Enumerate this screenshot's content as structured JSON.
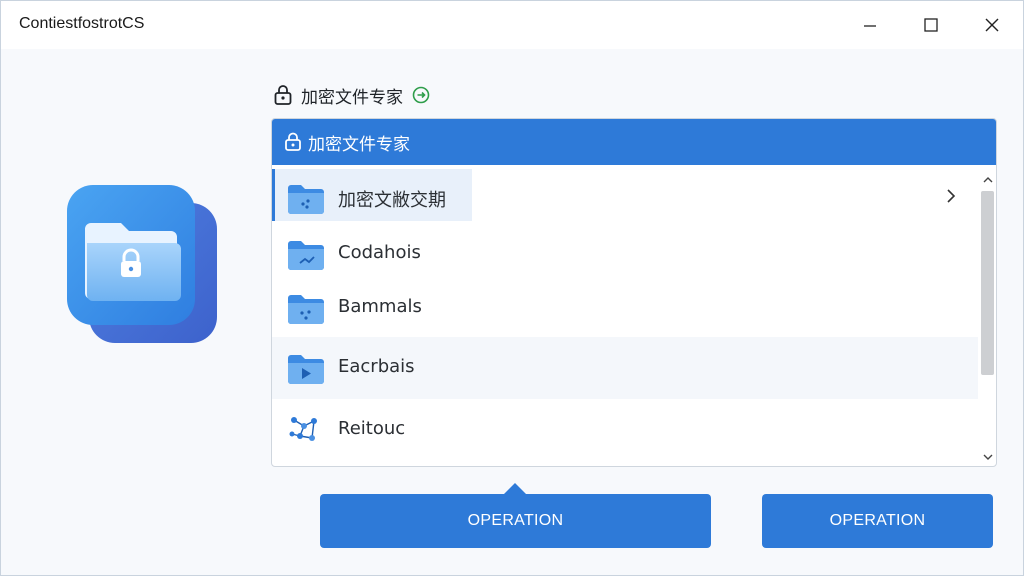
{
  "window": {
    "title": "ContiestfostrotCS"
  },
  "header": {
    "label": "加密文件专家",
    "lock_icon": "lock-icon",
    "status_icon": "sync-status-icon",
    "status_color": "#2e9d4a"
  },
  "panel": {
    "title": "加密文件专家",
    "accent": "#2e7ad8",
    "items": [
      {
        "label": "加密文敝交期",
        "icon": "folder-icon",
        "selected": true
      },
      {
        "label": "Codahois",
        "icon": "folder-icon"
      },
      {
        "label": "Bammals",
        "icon": "folder-icon"
      },
      {
        "label": "Eacrbais",
        "icon": "folder-video-icon"
      },
      {
        "label": "Reitouc",
        "icon": "network-icon"
      }
    ]
  },
  "buttons": {
    "primary": "OPERATION",
    "secondary": "OPERATION"
  }
}
